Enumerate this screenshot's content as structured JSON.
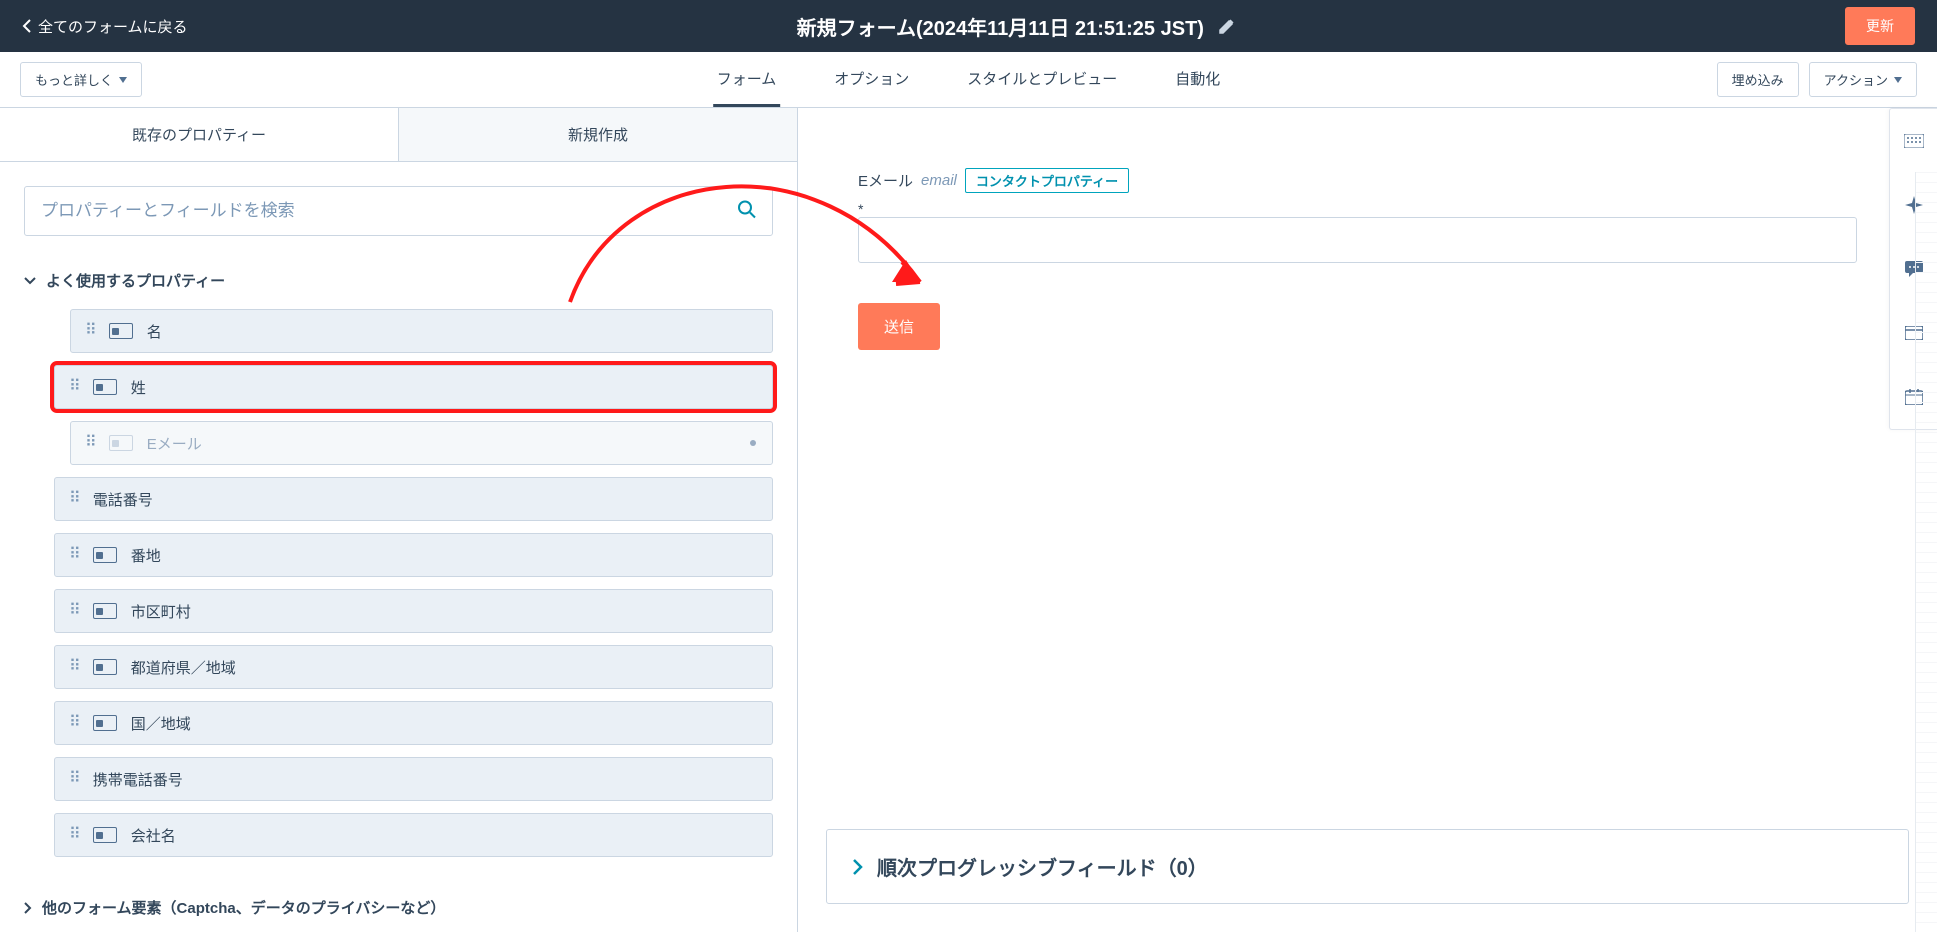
{
  "topbar": {
    "back_label": "全てのフォームに戻る",
    "title": "新規フォーム(2024年11月11日 21:51:25 JST)",
    "update_button": "更新"
  },
  "toolbar": {
    "more_button": "もっと詳しく",
    "tabs": [
      "フォーム",
      "オプション",
      "スタイルとプレビュー",
      "自動化"
    ],
    "embed_button": "埋め込み",
    "actions_button": "アクション"
  },
  "left": {
    "tabs": [
      "既存のプロパティー",
      "新規作成"
    ],
    "search_placeholder": "プロパティーとフィールドを検索",
    "group_common": "よく使用するプロパティー",
    "group_other": "他のフォーム要素（Captcha、データのプライバシーなど）",
    "props": [
      {
        "label": "名",
        "icon": true,
        "indented": true
      },
      {
        "label": "姓",
        "icon": true,
        "highlight": true
      },
      {
        "label": "Eメール",
        "icon": true,
        "indented": true,
        "disabled": true,
        "dot": true
      },
      {
        "label": "電話番号",
        "icon": false
      },
      {
        "label": "番地",
        "icon": true
      },
      {
        "label": "市区町村",
        "icon": true
      },
      {
        "label": "都道府県／地域",
        "icon": true
      },
      {
        "label": "国／地域",
        "icon": true
      },
      {
        "label": "携帯電話番号",
        "icon": false
      },
      {
        "label": "会社名",
        "icon": true
      }
    ]
  },
  "canvas": {
    "field_label_main": "Eメール",
    "field_label_italic": "email",
    "badge": "コンタクトプロパティー",
    "submit": "送信"
  },
  "progressive": {
    "label": "順次プログレッシブフィールド（0）"
  }
}
